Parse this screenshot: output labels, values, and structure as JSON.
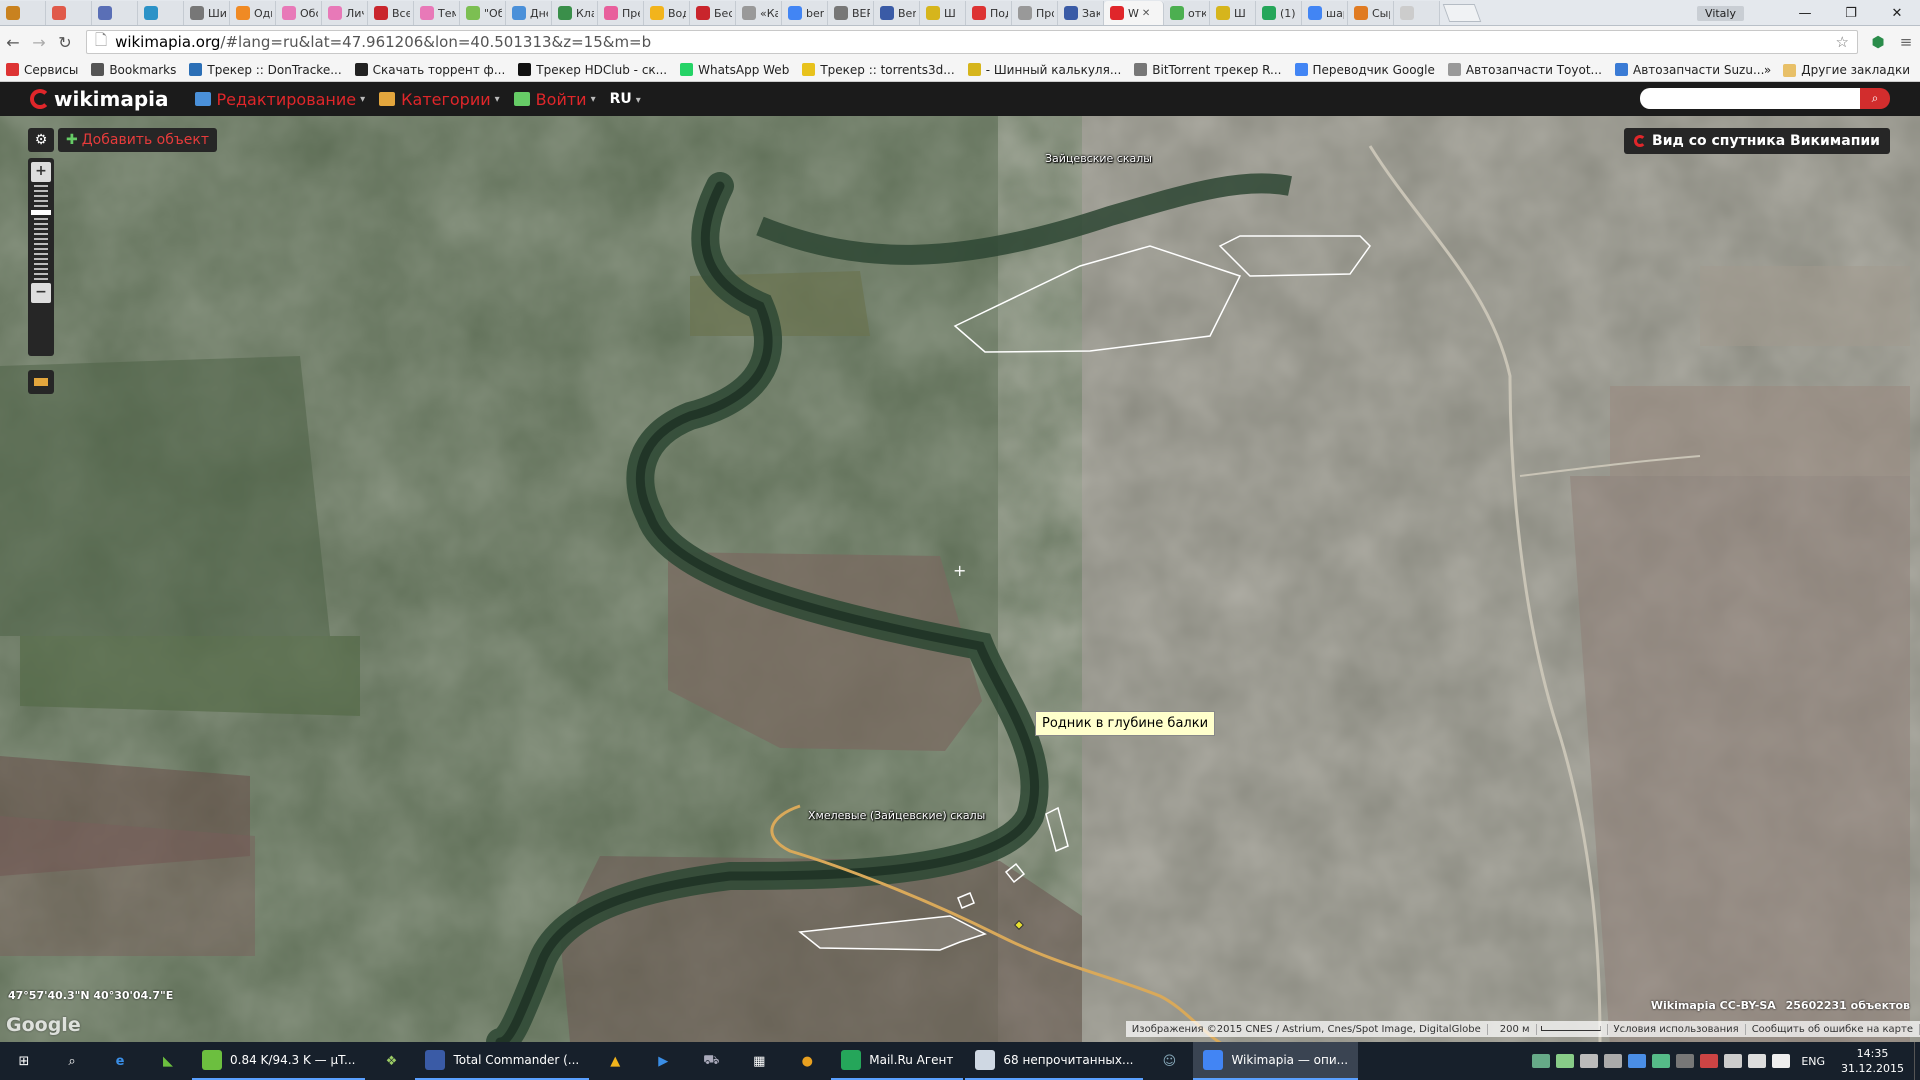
{
  "tabs": [
    {
      "label": "",
      "color": "#c9821f",
      "icon": "hd-icon"
    },
    {
      "label": "",
      "color": "#e05a4a",
      "icon": "calendar-icon"
    },
    {
      "label": "",
      "color": "#5a6fb6",
      "icon": "puzzle-icon"
    },
    {
      "label": "",
      "color": "#2b92c7",
      "icon": "app-icon"
    },
    {
      "label": "Ши",
      "color": "#777",
      "icon": "mask-icon"
    },
    {
      "label": "Одн",
      "color": "#f08a24",
      "icon": "odnoklassniki-icon"
    },
    {
      "label": "Обс",
      "color": "#e879b8",
      "icon": "flower-icon"
    },
    {
      "label": "Лич",
      "color": "#e879b8",
      "icon": "flower-icon"
    },
    {
      "label": "Все",
      "color": "#c9252c",
      "icon": "t-icon"
    },
    {
      "label": "Тем",
      "color": "#e879b8",
      "icon": "flower-icon"
    },
    {
      "label": "\"Об",
      "color": "#7cbf52",
      "icon": "leaf-icon"
    },
    {
      "label": "Дне",
      "color": "#4a90d9",
      "icon": "diary-icon"
    },
    {
      "label": "Клас",
      "color": "#3a8f4a",
      "icon": "check-icon"
    },
    {
      "label": "Пре",
      "color": "#e85f9c",
      "icon": "flower-icon"
    },
    {
      "label": "Вод",
      "color": "#f2b41c",
      "icon": "sun-icon"
    },
    {
      "label": "Бест",
      "color": "#c9252c",
      "icon": "d-icon"
    },
    {
      "label": "«Ка",
      "color": "#999",
      "icon": "deer-icon"
    },
    {
      "label": "berk",
      "color": "#4285f4",
      "icon": "google-icon"
    },
    {
      "label": "BER",
      "color": "#777",
      "icon": "bird-icon"
    },
    {
      "label": "Berk",
      "color": "#3a5ba6",
      "icon": "y-icon"
    },
    {
      "label": "Ш",
      "color": "#d6b51c",
      "icon": "sun-icon"
    },
    {
      "label": "Под",
      "color": "#d33",
      "icon": "pin-icon"
    },
    {
      "label": "Про",
      "color": "#999",
      "icon": "circle-icon"
    },
    {
      "label": "Зака",
      "color": "#3a5ba6",
      "icon": "ak-icon"
    },
    {
      "label": "W",
      "color": "#e0262a",
      "icon": "wikimapia-icon"
    },
    {
      "label": "отк",
      "color": "#4caf50",
      "icon": "maps-icon"
    },
    {
      "label": "Ш",
      "color": "#d6b51c",
      "icon": "sun-icon"
    },
    {
      "label": "(1) V",
      "color": "#25a65a",
      "icon": "v-icon"
    },
    {
      "label": "шар",
      "color": "#4285f4",
      "icon": "google-icon"
    },
    {
      "label": "Сыр",
      "color": "#e07b22",
      "icon": "grid-icon"
    },
    {
      "label": "",
      "color": "#ccc",
      "icon": "blank-icon"
    }
  ],
  "active_tab_index": 24,
  "window": {
    "user": "Vitaly",
    "min": "—",
    "max": "❐",
    "close": "✕"
  },
  "address": {
    "host": "wikimapia.org",
    "rest": "/#lang=ru&lat=47.961206&lon=40.501313&z=15&m=b"
  },
  "bookmarks": [
    {
      "label": "Сервисы",
      "color": "#d33"
    },
    {
      "label": "Bookmarks",
      "color": "#555"
    },
    {
      "label": "Трекер :: DonTracke...",
      "color": "#2b6fb6"
    },
    {
      "label": "Скачать торрент ф...",
      "color": "#222"
    },
    {
      "label": "Трекер HDClub - ск...",
      "color": "#111"
    },
    {
      "label": "WhatsApp Web",
      "color": "#25d366"
    },
    {
      "label": "Трекер :: torrents3d...",
      "color": "#e8c21c"
    },
    {
      "label": "- Шинный калькуля...",
      "color": "#d6b51c"
    },
    {
      "label": "BitTorrent трекер R...",
      "color": "#777"
    },
    {
      "label": "Переводчик Google",
      "color": "#4285f4"
    },
    {
      "label": "Автозапчасти Тoyot...",
      "color": "#999"
    },
    {
      "label": "Автозапчасти Suzu...",
      "color": "#3a7bd5"
    }
  ],
  "bookmarks_more": "»",
  "bookmarks_other": "Другие закладки",
  "wm": {
    "logo": "wikimapia",
    "menu": [
      {
        "label": "Редактирование",
        "icon": "globe-icon",
        "color": "#4a90d9"
      },
      {
        "label": "Категории",
        "icon": "list-icon",
        "color": "#e3a63d"
      },
      {
        "label": "Войти",
        "icon": "login-icon",
        "color": "#6c6"
      }
    ],
    "lang": "RU",
    "search_placeholder": "",
    "search_icon": "🔍"
  },
  "map": {
    "add_object": "Добавить объект",
    "sat_view": "Вид со спутника Викимапии",
    "labels": [
      {
        "text": "Зайцевские скалы"
      },
      {
        "text": "Хмелевые (Зайцевские) скалы"
      }
    ],
    "tooltip": "Родник в глубине балки",
    "coords": "47°57'40.3\"N 40°30'04.7\"E",
    "google": "Google",
    "credit_name": "Wikimapia CC-BY-SA",
    "credit_count": "25602231 объектов",
    "attribution": [
      "Изображения ©2015 CNES / Astrium, Cnes/Spot Image, DigitalGlobe",
      "200 м",
      "Условия использования",
      "Сообщить об ошибке на карте"
    ]
  },
  "taskbar": {
    "apps": [
      {
        "label": "0.84 K/94.3 K — µT...",
        "color": "#6cbf3f"
      },
      {
        "label": "Total Commander (...",
        "color": "#3a5ba6"
      },
      {
        "label": "Mail.Ru Агент",
        "color": "#25a65a"
      },
      {
        "label": "68 непрочитанных...",
        "color": "#cfd8e3"
      },
      {
        "label": "Wikimapia — опи...",
        "color": "#4285f4"
      }
    ],
    "lang": "ENG",
    "time": "14:35",
    "date": "31.12.2015"
  }
}
